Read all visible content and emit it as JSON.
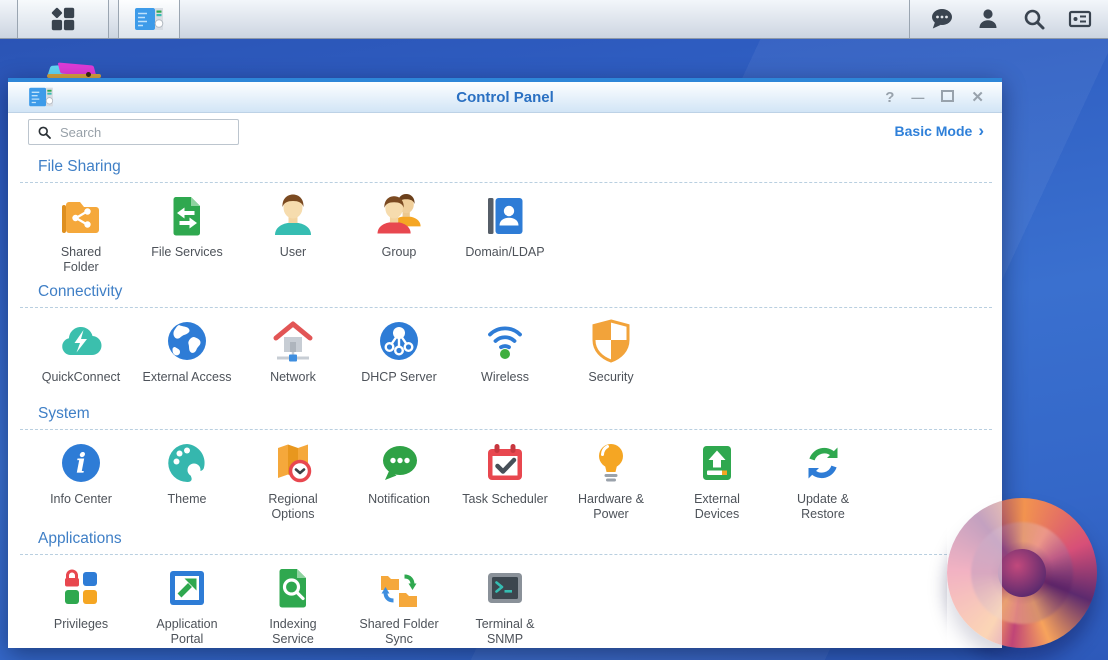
{
  "taskbar": {
    "buttons": [
      {
        "name": "main-menu"
      },
      {
        "name": "control-panel"
      }
    ],
    "status_icons": [
      {
        "name": "chat"
      },
      {
        "name": "user"
      },
      {
        "name": "search"
      },
      {
        "name": "widgets"
      }
    ]
  },
  "window": {
    "title": "Control Panel",
    "help_glyph": "?",
    "minimize_glyph": "—",
    "close_glyph": "✕",
    "search_placeholder": "Search",
    "basic_mode_label": "Basic Mode",
    "basic_mode_chevron": "›",
    "sections": [
      {
        "title": "File Sharing",
        "items": [
          {
            "label": "Shared\nFolder",
            "icon": "shared-folder"
          },
          {
            "label": "File Services",
            "icon": "file-services"
          },
          {
            "label": "User",
            "icon": "user"
          },
          {
            "label": "Group",
            "icon": "group"
          },
          {
            "label": "Domain/LDAP",
            "icon": "domain-ldap"
          }
        ]
      },
      {
        "title": "Connectivity",
        "items": [
          {
            "label": "QuickConnect",
            "icon": "quickconnect"
          },
          {
            "label": "External Access",
            "icon": "external-access"
          },
          {
            "label": "Network",
            "icon": "network"
          },
          {
            "label": "DHCP Server",
            "icon": "dhcp-server"
          },
          {
            "label": "Wireless",
            "icon": "wireless"
          },
          {
            "label": "Security",
            "icon": "security"
          }
        ]
      },
      {
        "title": "System",
        "items": [
          {
            "label": "Info Center",
            "icon": "info-center"
          },
          {
            "label": "Theme",
            "icon": "theme"
          },
          {
            "label": "Regional\nOptions",
            "icon": "regional-options"
          },
          {
            "label": "Notification",
            "icon": "notification"
          },
          {
            "label": "Task Scheduler",
            "icon": "task-scheduler"
          },
          {
            "label": "Hardware &\nPower",
            "icon": "hardware-power"
          },
          {
            "label": "External\nDevices",
            "icon": "external-devices"
          },
          {
            "label": "Update &\nRestore",
            "icon": "update-restore"
          }
        ]
      },
      {
        "title": "Applications",
        "items": [
          {
            "label": "Privileges",
            "icon": "privileges"
          },
          {
            "label": "Application\nPortal",
            "icon": "application-portal"
          },
          {
            "label": "Indexing\nService",
            "icon": "indexing-service"
          },
          {
            "label": "Shared Folder\nSync",
            "icon": "shared-folder-sync"
          },
          {
            "label": "Terminal &\nSNMP",
            "icon": "terminal-snmp"
          }
        ]
      }
    ]
  },
  "colors": {
    "accent_blue": "#2E7CD6",
    "section_title_blue": "#3F7FC6",
    "basic_mode_blue": "#2F80D9",
    "title_text_blue": "#2A70C2",
    "desktop_blue": "#3465C8",
    "orange": "#F5A83B",
    "green": "#2FA84F",
    "teal": "#35BDB2",
    "red": "#E8474F"
  }
}
